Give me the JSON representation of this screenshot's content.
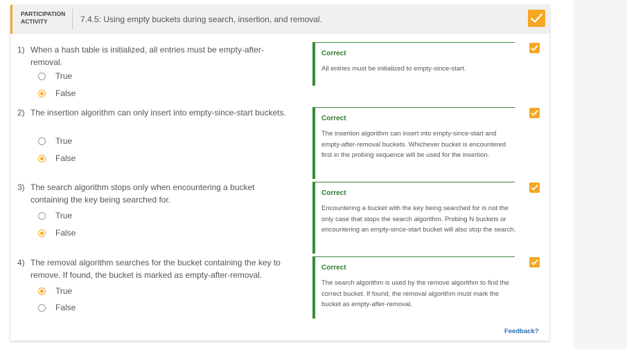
{
  "header": {
    "participation_line1": "PARTICIPATION",
    "participation_line2": "ACTIVITY",
    "title": "7.4.5: Using empty buckets during search, insertion, and removal."
  },
  "questions": [
    {
      "number": "1)",
      "text": "When a hash table is initialized, all entries must be empty-after-removal.",
      "options": [
        {
          "label": "True",
          "selected": false
        },
        {
          "label": "False",
          "selected": true
        }
      ],
      "feedback": {
        "title": "Correct",
        "text": "All entries must be initialized to empty-since-start."
      }
    },
    {
      "number": "2)",
      "text": "The insertion algorithm can only insert into empty-since-start buckets.",
      "options": [
        {
          "label": "True",
          "selected": false
        },
        {
          "label": "False",
          "selected": true
        }
      ],
      "feedback": {
        "title": "Correct",
        "text": "The insertion algorithm can insert into empty-since-start and empty-after-removal buckets. Whichever bucket is encountered first in the probing sequence will be used for the insertion."
      }
    },
    {
      "number": "3)",
      "text": "The search algorithm stops only when encountering a bucket containing the key being searched for.",
      "options": [
        {
          "label": "True",
          "selected": false
        },
        {
          "label": "False",
          "selected": true
        }
      ],
      "feedback": {
        "title": "Correct",
        "text": "Encountering a bucket with the key being searched for is not the only case that stops the search algorithm. Probing N buckets or encountering an empty-since-start bucket will also stop the search."
      }
    },
    {
      "number": "4)",
      "text": "The removal algorithm searches for the bucket containing the key to remove. If found, the bucket is marked as empty-after-removal.",
      "options": [
        {
          "label": "True",
          "selected": true
        },
        {
          "label": "False",
          "selected": false
        }
      ],
      "feedback": {
        "title": "Correct",
        "text": "The search algorithm is used by the remove algorithm to find the correct bucket. If found, the removal algorithm must mark the bucket as empty-after-removal."
      }
    }
  ],
  "feedback_link": "Feedback?",
  "colors": {
    "accent": "#f5a623",
    "correct": "#3a8a3a",
    "link": "#2a6fb5"
  },
  "icons": {
    "complete": "checkmark-icon",
    "question_status": "checkmark-icon"
  }
}
